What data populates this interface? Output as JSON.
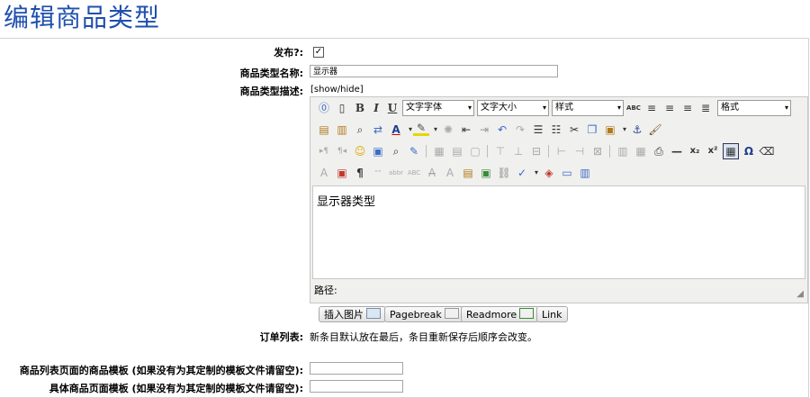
{
  "page": {
    "title": "编辑商品类型"
  },
  "form": {
    "publish_label": "发布?:",
    "publish_check": "✓",
    "name_label": "商品类型名称:",
    "name_value": "显示器",
    "desc_label": "商品类型描述:",
    "desc_toggle": "[show/hide]",
    "order_label": "订单列表:",
    "order_value": "新条目默认放在最后，条目重新保存后顺序会改变。",
    "list_template_label": "商品列表页面的商品模板 (如果没有为其定制的模板文件请留空):",
    "list_template_value": "",
    "detail_template_label": "具体商品页面模板 (如果没有为其定制的模板文件请留空):",
    "detail_template_value": ""
  },
  "editor": {
    "font_family": "文字字体",
    "font_size": "文字大小",
    "style": "样式",
    "format": "格式",
    "content": "显示器类型",
    "path_label": "路径:"
  },
  "buttons": {
    "insert_image": "插入图片",
    "pagebreak": "Pagebreak",
    "readmore": "Readmore",
    "link": "Link"
  }
}
